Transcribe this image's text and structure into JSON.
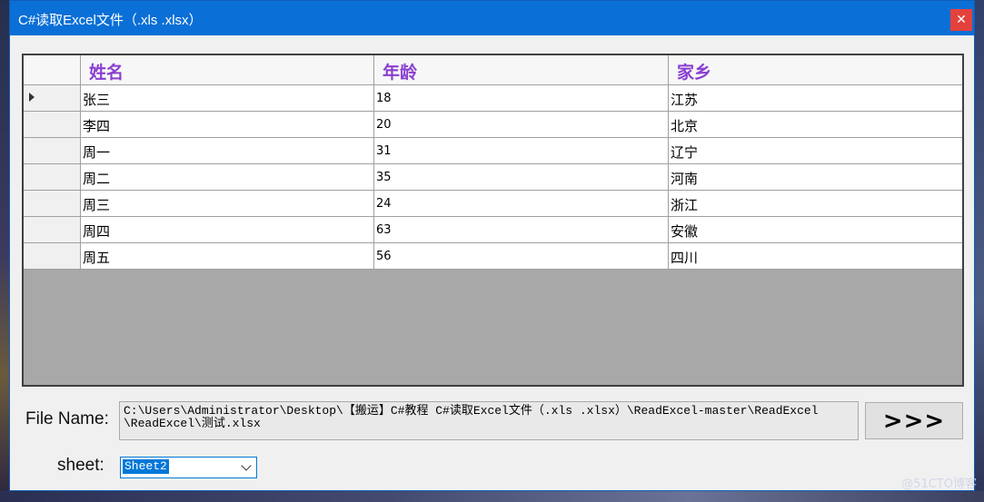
{
  "window": {
    "title": "C#读取Excel文件（.xls .xlsx）",
    "close_glyph": "✕"
  },
  "grid": {
    "columns": [
      "姓名",
      "年龄",
      "家乡"
    ],
    "rows": [
      {
        "name": "张三",
        "age": "18",
        "home": "江苏"
      },
      {
        "name": "李四",
        "age": "20",
        "home": "北京"
      },
      {
        "name": "周一",
        "age": "31",
        "home": "辽宁"
      },
      {
        "name": "周二",
        "age": "35",
        "home": "河南"
      },
      {
        "name": "周三",
        "age": "24",
        "home": "浙江"
      },
      {
        "name": "周四",
        "age": "63",
        "home": "安徽"
      },
      {
        "name": "周五",
        "age": "56",
        "home": "四川"
      }
    ],
    "header_color": "#8a3fd1"
  },
  "file": {
    "label": "File Name:",
    "path": "C:\\Users\\Administrator\\Desktop\\【搬运】C#教程 C#读取Excel文件（.xls .xlsx）\\ReadExcel-master\\ReadExcel\n\\ReadExcel\\测试.xlsx",
    "go_label": ">>>"
  },
  "sheet": {
    "label": "sheet:",
    "selected": "Sheet2"
  },
  "watermark": "@51CTO博客"
}
